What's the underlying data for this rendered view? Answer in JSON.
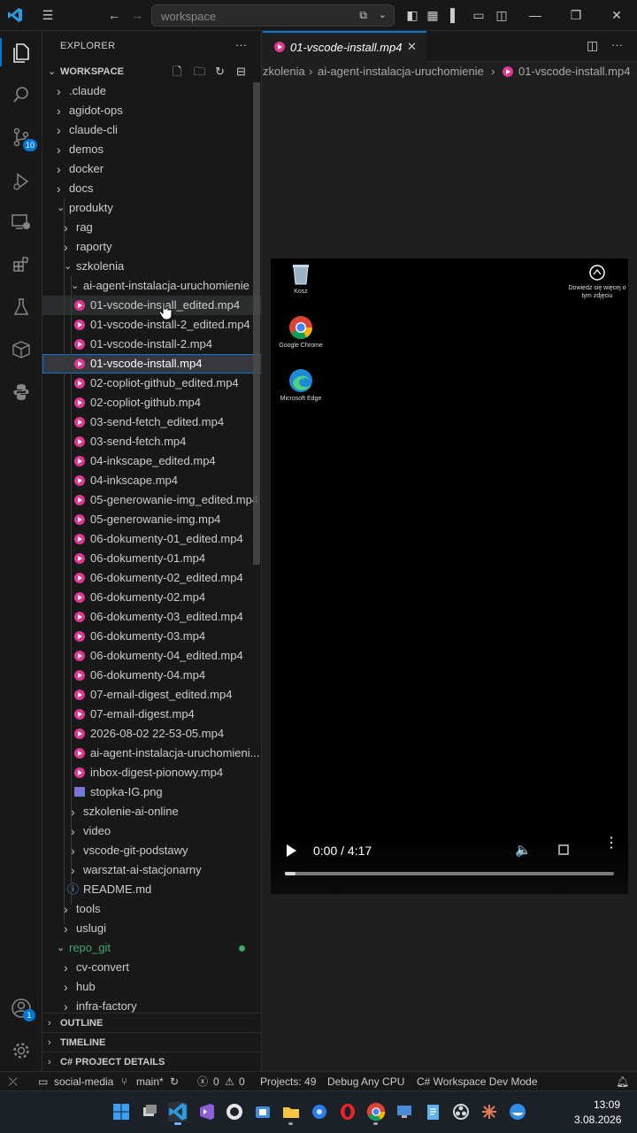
{
  "titlebar": {
    "search_text": "workspace"
  },
  "activity_badges": {
    "source_control": "10",
    "accounts": "1"
  },
  "explorer": {
    "title": "EXPLORER",
    "more": "···",
    "workspace_label": "WORKSPACE",
    "items": [
      {
        "label": ".claude"
      },
      {
        "label": "agidot-ops"
      },
      {
        "label": "claude-cli"
      },
      {
        "label": "demos"
      },
      {
        "label": "docker"
      },
      {
        "label": "docs"
      },
      {
        "label": "produkty"
      },
      {
        "label": "rag"
      },
      {
        "label": "raporty"
      },
      {
        "label": "szkolenia"
      },
      {
        "label": "ai-agent-instalacja-uruchomienie"
      },
      {
        "label": "01-vscode-install_edited.mp4"
      },
      {
        "label": "01-vscode-install-2_edited.mp4"
      },
      {
        "label": "01-vscode-install-2.mp4"
      },
      {
        "label": "01-vscode-install.mp4"
      },
      {
        "label": "02-copliot-github_edited.mp4"
      },
      {
        "label": "02-copliot-github.mp4"
      },
      {
        "label": "03-send-fetch_edited.mp4"
      },
      {
        "label": "03-send-fetch.mp4"
      },
      {
        "label": "04-inkscape_edited.mp4"
      },
      {
        "label": "04-inkscape.mp4"
      },
      {
        "label": "05-generowanie-img_edited.mp4"
      },
      {
        "label": "05-generowanie-img.mp4"
      },
      {
        "label": "06-dokumenty-01_edited.mp4"
      },
      {
        "label": "06-dokumenty-01.mp4"
      },
      {
        "label": "06-dokumenty-02_edited.mp4"
      },
      {
        "label": "06-dokumenty-02.mp4"
      },
      {
        "label": "06-dokumenty-03_edited.mp4"
      },
      {
        "label": "06-dokumenty-03.mp4"
      },
      {
        "label": "06-dokumenty-04_edited.mp4"
      },
      {
        "label": "06-dokumenty-04.mp4"
      },
      {
        "label": "07-email-digest_edited.mp4"
      },
      {
        "label": "07-email-digest.mp4"
      },
      {
        "label": "2026-08-02 22-53-05.mp4"
      },
      {
        "label": "ai-agent-instalacja-uruchomieni..."
      },
      {
        "label": "inbox-digest-pionowy.mp4"
      },
      {
        "label": "stopka-IG.png"
      },
      {
        "label": "szkolenie-ai-online"
      },
      {
        "label": "video"
      },
      {
        "label": "vscode-git-podstawy"
      },
      {
        "label": "warsztat-ai-stacjonarny"
      },
      {
        "label": "README.md"
      },
      {
        "label": "tools"
      },
      {
        "label": "uslugi"
      },
      {
        "label": "repo_git"
      },
      {
        "label": "cv-convert"
      },
      {
        "label": "hub"
      },
      {
        "label": "infra-factory"
      }
    ],
    "sections": [
      "OUTLINE",
      "TIMELINE",
      "C# PROJECT DETAILS"
    ]
  },
  "editor": {
    "tab_label": "01-vscode-install.mp4",
    "breadcrumb": [
      "zkolenia",
      "ai-agent-instalacja-uruchomienie",
      "01-vscode-install.mp4"
    ],
    "video": {
      "desktop_icons": [
        "Kosz",
        "Google Chrome",
        "Microsoft Edge"
      ],
      "learn_more": "Dowiedz się więcej o tym zdjęciu",
      "time": "0:00 / 4:17",
      "progress": 0.0
    }
  },
  "statusbar": {
    "remote": "",
    "project": "social-media",
    "branch": "main*",
    "errors": "0",
    "warnings": "0",
    "projects": "Projects: 49",
    "debug": "Debug Any CPU",
    "mode": "C# Workspace Dev Mode"
  },
  "taskbar": {
    "time": "13:09",
    "date": "3.08.2026"
  },
  "colors": {
    "accent": "#0078d4",
    "mp4": "#e0368f",
    "git_dot": "#3fa86b"
  }
}
